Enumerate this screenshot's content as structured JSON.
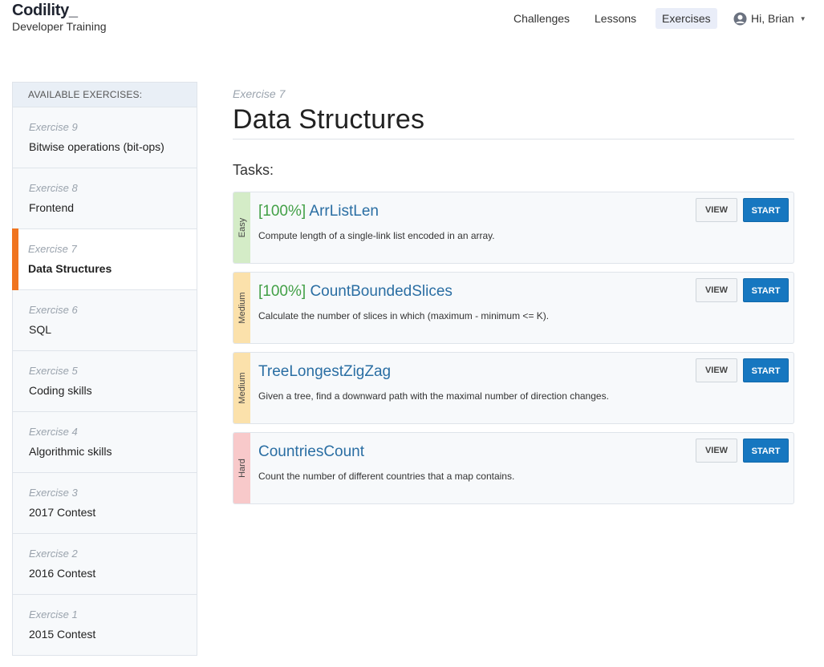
{
  "header": {
    "logo": "Codility_",
    "subtitle": "Developer Training",
    "nav": [
      {
        "label": "Challenges",
        "active": false
      },
      {
        "label": "Lessons",
        "active": false
      },
      {
        "label": "Exercises",
        "active": true
      }
    ],
    "user": {
      "greeting": "Hi, Brian",
      "icon": "user-circle-icon",
      "caret_icon": "caret-down-icon"
    }
  },
  "sidebar": {
    "header": "AVAILABLE EXERCISES:",
    "items": [
      {
        "number": "Exercise 9",
        "name": "Bitwise operations (bit-ops)",
        "active": false
      },
      {
        "number": "Exercise 8",
        "name": "Frontend",
        "active": false
      },
      {
        "number": "Exercise 7",
        "name": "Data Structures",
        "active": true
      },
      {
        "number": "Exercise 6",
        "name": "SQL",
        "active": false
      },
      {
        "number": "Exercise 5",
        "name": "Coding skills",
        "active": false
      },
      {
        "number": "Exercise 4",
        "name": "Algorithmic skills",
        "active": false
      },
      {
        "number": "Exercise 3",
        "name": "2017 Contest",
        "active": false
      },
      {
        "number": "Exercise 2",
        "name": "2016 Contest",
        "active": false
      },
      {
        "number": "Exercise 1",
        "name": "2015 Contest",
        "active": false
      }
    ],
    "accent_color": "#f0741f"
  },
  "main": {
    "exercise_number": "Exercise 7",
    "title": "Data Structures",
    "tasks_label": "Tasks:",
    "tasks": [
      {
        "difficulty": "Easy",
        "difficulty_color": "#d4ecc7",
        "score": "[100%]",
        "name": "ArrListLen",
        "description": "Compute length of a single-link list encoded in an array.",
        "view_label": "VIEW",
        "start_label": "START"
      },
      {
        "difficulty": "Medium",
        "difficulty_color": "#fbe1ab",
        "score": "[100%]",
        "name": "CountBoundedSlices",
        "description": "Calculate the number of slices in which (maximum - minimum <= K).",
        "view_label": "VIEW",
        "start_label": "START"
      },
      {
        "difficulty": "Medium",
        "difficulty_color": "#fbe1ab",
        "score": "",
        "name": "TreeLongestZigZag",
        "description": "Given a tree, find a downward path with the maximal number of direction changes.",
        "view_label": "VIEW",
        "start_label": "START"
      },
      {
        "difficulty": "Hard",
        "difficulty_color": "#f8c9ca",
        "score": "",
        "name": "CountriesCount",
        "description": "Count the number of different countries that a map contains.",
        "view_label": "VIEW",
        "start_label": "START"
      }
    ]
  },
  "colors": {
    "link": "#2a6ea3",
    "score": "#43a047",
    "primary_button": "#1677c0"
  }
}
